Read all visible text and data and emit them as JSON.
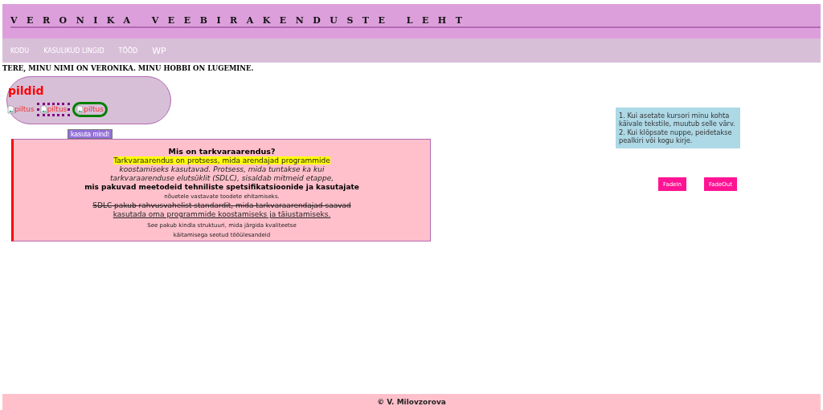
{
  "header": {
    "title": "VERONIKA VEEBIRAKENDUSTE LEHT"
  },
  "nav": [
    {
      "label": "KODU",
      "kind": "small"
    },
    {
      "label": "KASULIKUD LINGID",
      "kind": "small"
    },
    {
      "label": "TÖÖD",
      "kind": "small"
    },
    {
      "label": "WP",
      "kind": "large"
    }
  ],
  "greeting": "TERE, MINU NIMI ON VERONIKA. MINU HOBBI ON LUGEMINE.",
  "gallery": {
    "title": "pildid",
    "images": [
      {
        "alt": "piltus",
        "kind": "plain"
      },
      {
        "alt": "piltus",
        "kind": "dotted"
      },
      {
        "alt": "piltus",
        "kind": "ringed"
      }
    ]
  },
  "use_button": "kasuta mind!",
  "article": [
    {
      "kind": "heading",
      "text": "Mis on tarkvaraarendus?"
    },
    {
      "kind": "highlight",
      "text": "Tarkvaraarendus on protsess, mida arendajad programmide"
    },
    {
      "kind": "italic",
      "text": "koostamiseks kasutavad. Protsess, mida tuntakse ka kui"
    },
    {
      "kind": "italic",
      "text": "tarkvaraarenduse elutsüklit (SDLC), sisaldab mitmeid etappe,"
    },
    {
      "kind": "bold",
      "text": "mis pakuvad meetodeid tehniliste spetsifikatsioonide ja kasutajate"
    },
    {
      "kind": "small",
      "text": "nõuetele vastavate toodete ehitamiseks."
    },
    {
      "kind": "strike",
      "text": "SDLC pakub rahvusvahelist standardit, mida tarkvaraarendajad saavad"
    },
    {
      "kind": "underline",
      "text": "kasutada oma programmide koostamiseks ja täiustamiseks."
    },
    {
      "kind": "note",
      "text": "See pakub kindla struktuuri, mida järgida kvaliteetse"
    },
    {
      "kind": "small",
      "text": "käitamisega seotud tööülesandeid"
    }
  ],
  "info": "1. Kui asetate kursori minu kohta käivale tekstile, muutub selle värv. 2. Kui klõpsate nuppe, peidetakse pealkiri või kogu kirje.",
  "buttons": [
    "FadeIn",
    "FadeOut"
  ],
  "footer": "© V. Milovzorova"
}
